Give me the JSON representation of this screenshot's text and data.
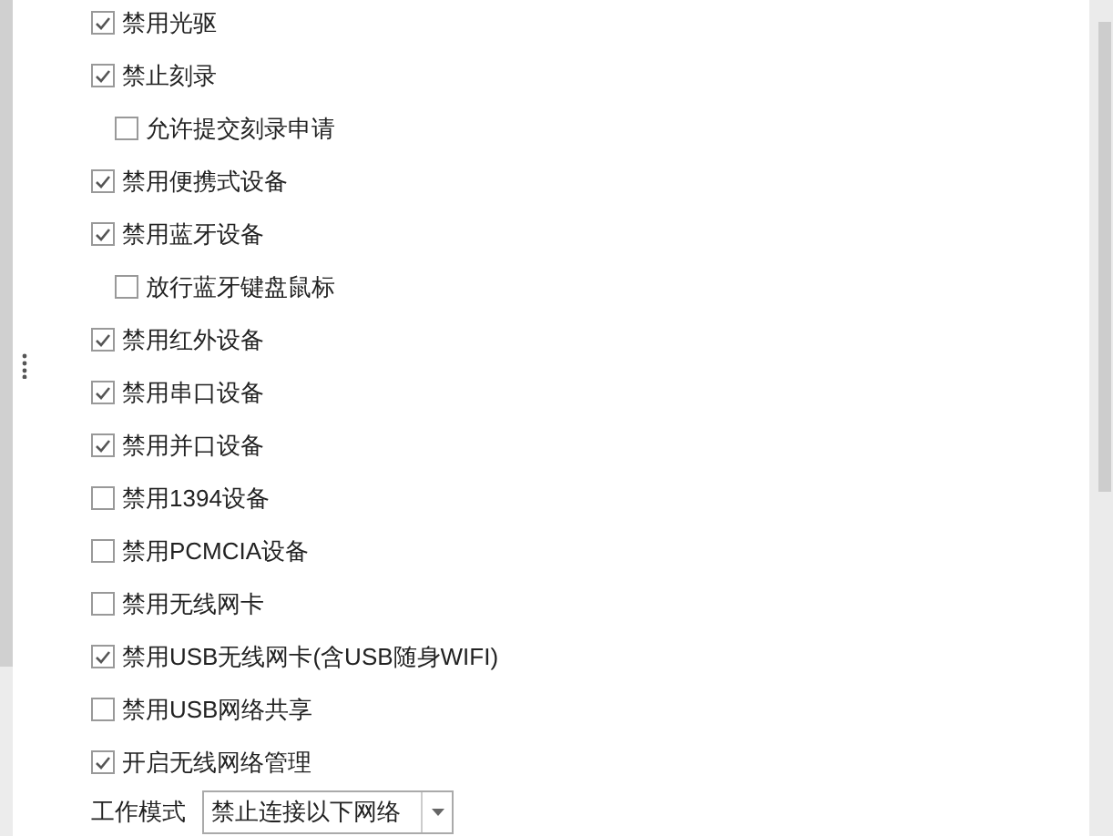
{
  "options": [
    {
      "label": "禁用光驱",
      "checked": true
    },
    {
      "label": "禁止刻录",
      "checked": true,
      "children": [
        {
          "label": "允许提交刻录申请",
          "checked": false
        }
      ]
    },
    {
      "label": "禁用便携式设备",
      "checked": true
    },
    {
      "label": "禁用蓝牙设备",
      "checked": true,
      "children": [
        {
          "label": "放行蓝牙键盘鼠标",
          "checked": false
        }
      ]
    },
    {
      "label": "禁用红外设备",
      "checked": true
    },
    {
      "label": "禁用串口设备",
      "checked": true
    },
    {
      "label": "禁用并口设备",
      "checked": true
    },
    {
      "label": "禁用1394设备",
      "checked": false
    },
    {
      "label": "禁用PCMCIA设备",
      "checked": false
    },
    {
      "label": "禁用无线网卡",
      "checked": false
    },
    {
      "label": "禁用USB无线网卡(含USB随身WIFI)",
      "checked": true
    },
    {
      "label": "禁用USB网络共享",
      "checked": false
    },
    {
      "label": "开启无线网络管理",
      "checked": true
    }
  ],
  "work_mode": {
    "label": "工作模式",
    "value": "禁止连接以下网络"
  }
}
